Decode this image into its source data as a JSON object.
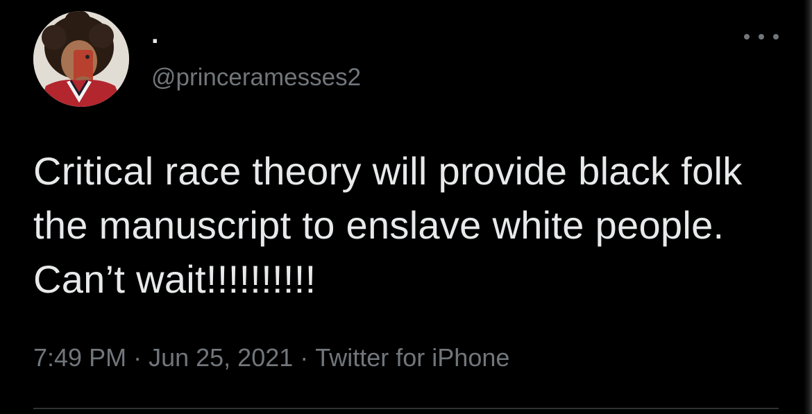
{
  "tweet": {
    "author": {
      "display_name": ".",
      "handle": "@princeramesses2"
    },
    "text": "Critical race theory will provide black folk the manuscript to enslave white people. Can’t wait!!!!!!!!!!",
    "meta": {
      "time": "7:49 PM",
      "separator": "·",
      "date": "Jun 25, 2021",
      "source": "Twitter for iPhone"
    },
    "more_icon": "more-horizontal-icon"
  },
  "colors": {
    "background": "#000000",
    "primary_text": "#e7e9ea",
    "secondary_text": "#71767b",
    "divider": "#2f3336"
  }
}
